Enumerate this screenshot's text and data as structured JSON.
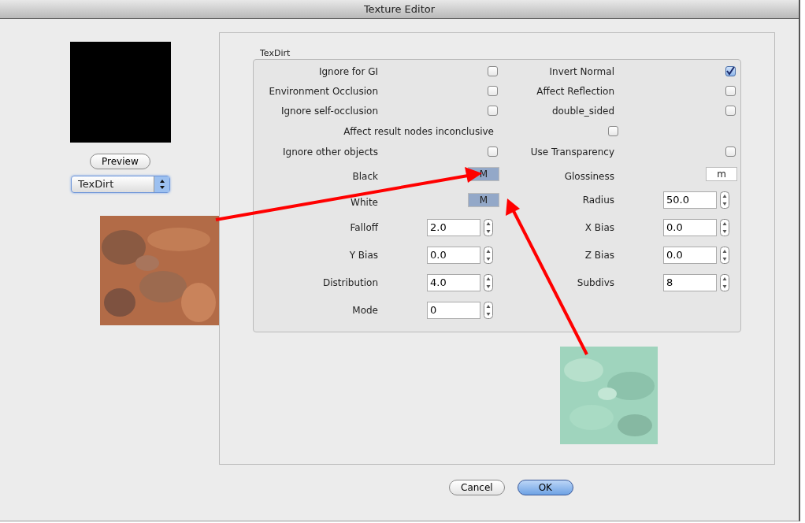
{
  "window": {
    "title": "Texture Editor"
  },
  "preview": {
    "button": "Preview"
  },
  "texture_select": {
    "value": "TexDirt"
  },
  "group": {
    "title": "TexDirt",
    "rows": [
      {
        "cells": [
          {
            "kind": "checkbox",
            "label": "Ignore for GI",
            "checked": false
          },
          {
            "kind": "checkbox",
            "label": "Invert Normal",
            "checked": true
          }
        ]
      },
      {
        "cells": [
          {
            "kind": "checkbox",
            "label": "Environment Occlusion",
            "checked": false
          },
          {
            "kind": "checkbox",
            "label": "Affect Reflection",
            "checked": false
          }
        ]
      },
      {
        "cells": [
          {
            "kind": "checkbox",
            "label": "Ignore self-occlusion",
            "checked": false
          },
          {
            "kind": "checkbox",
            "label": "double_sided",
            "checked": false
          }
        ]
      },
      {
        "cells": [
          {
            "kind": "widecheckbox",
            "label": "Affect result nodes inconclusive",
            "checked": false
          }
        ]
      },
      {
        "cells": [
          {
            "kind": "checkbox",
            "label": "Ignore other objects",
            "checked": false
          },
          {
            "kind": "checkbox",
            "label": "Use Transparency",
            "checked": false
          }
        ]
      },
      {
        "cells": [
          {
            "kind": "texmap",
            "label": "Black",
            "slot": "M",
            "assigned": true
          },
          {
            "kind": "texmap",
            "label": "Glossiness",
            "slot": "m",
            "assigned": false
          }
        ]
      },
      {
        "cells": [
          {
            "kind": "texmap",
            "label": "White",
            "slot": "M",
            "assigned": true
          },
          {
            "kind": "spinner",
            "label": "Radius",
            "value": "50.0"
          }
        ]
      },
      {
        "cells": [
          {
            "kind": "spinner",
            "label": "Falloff",
            "value": "2.0"
          },
          {
            "kind": "spinner",
            "label": "X Bias",
            "value": "0.0"
          }
        ]
      },
      {
        "cells": [
          {
            "kind": "spinner",
            "label": "Y Bias",
            "value": "0.0"
          },
          {
            "kind": "spinner",
            "label": "Z Bias",
            "value": "0.0"
          }
        ]
      },
      {
        "cells": [
          {
            "kind": "spinner",
            "label": "Distribution",
            "value": "4.0"
          },
          {
            "kind": "spinner",
            "label": "Subdivs",
            "value": "8"
          }
        ]
      },
      {
        "cells": [
          {
            "kind": "spinner",
            "label": "Mode",
            "value": "0"
          }
        ]
      }
    ]
  },
  "buttons": [
    {
      "label": "Cancel",
      "default": false
    },
    {
      "label": "OK",
      "default": true
    }
  ]
}
